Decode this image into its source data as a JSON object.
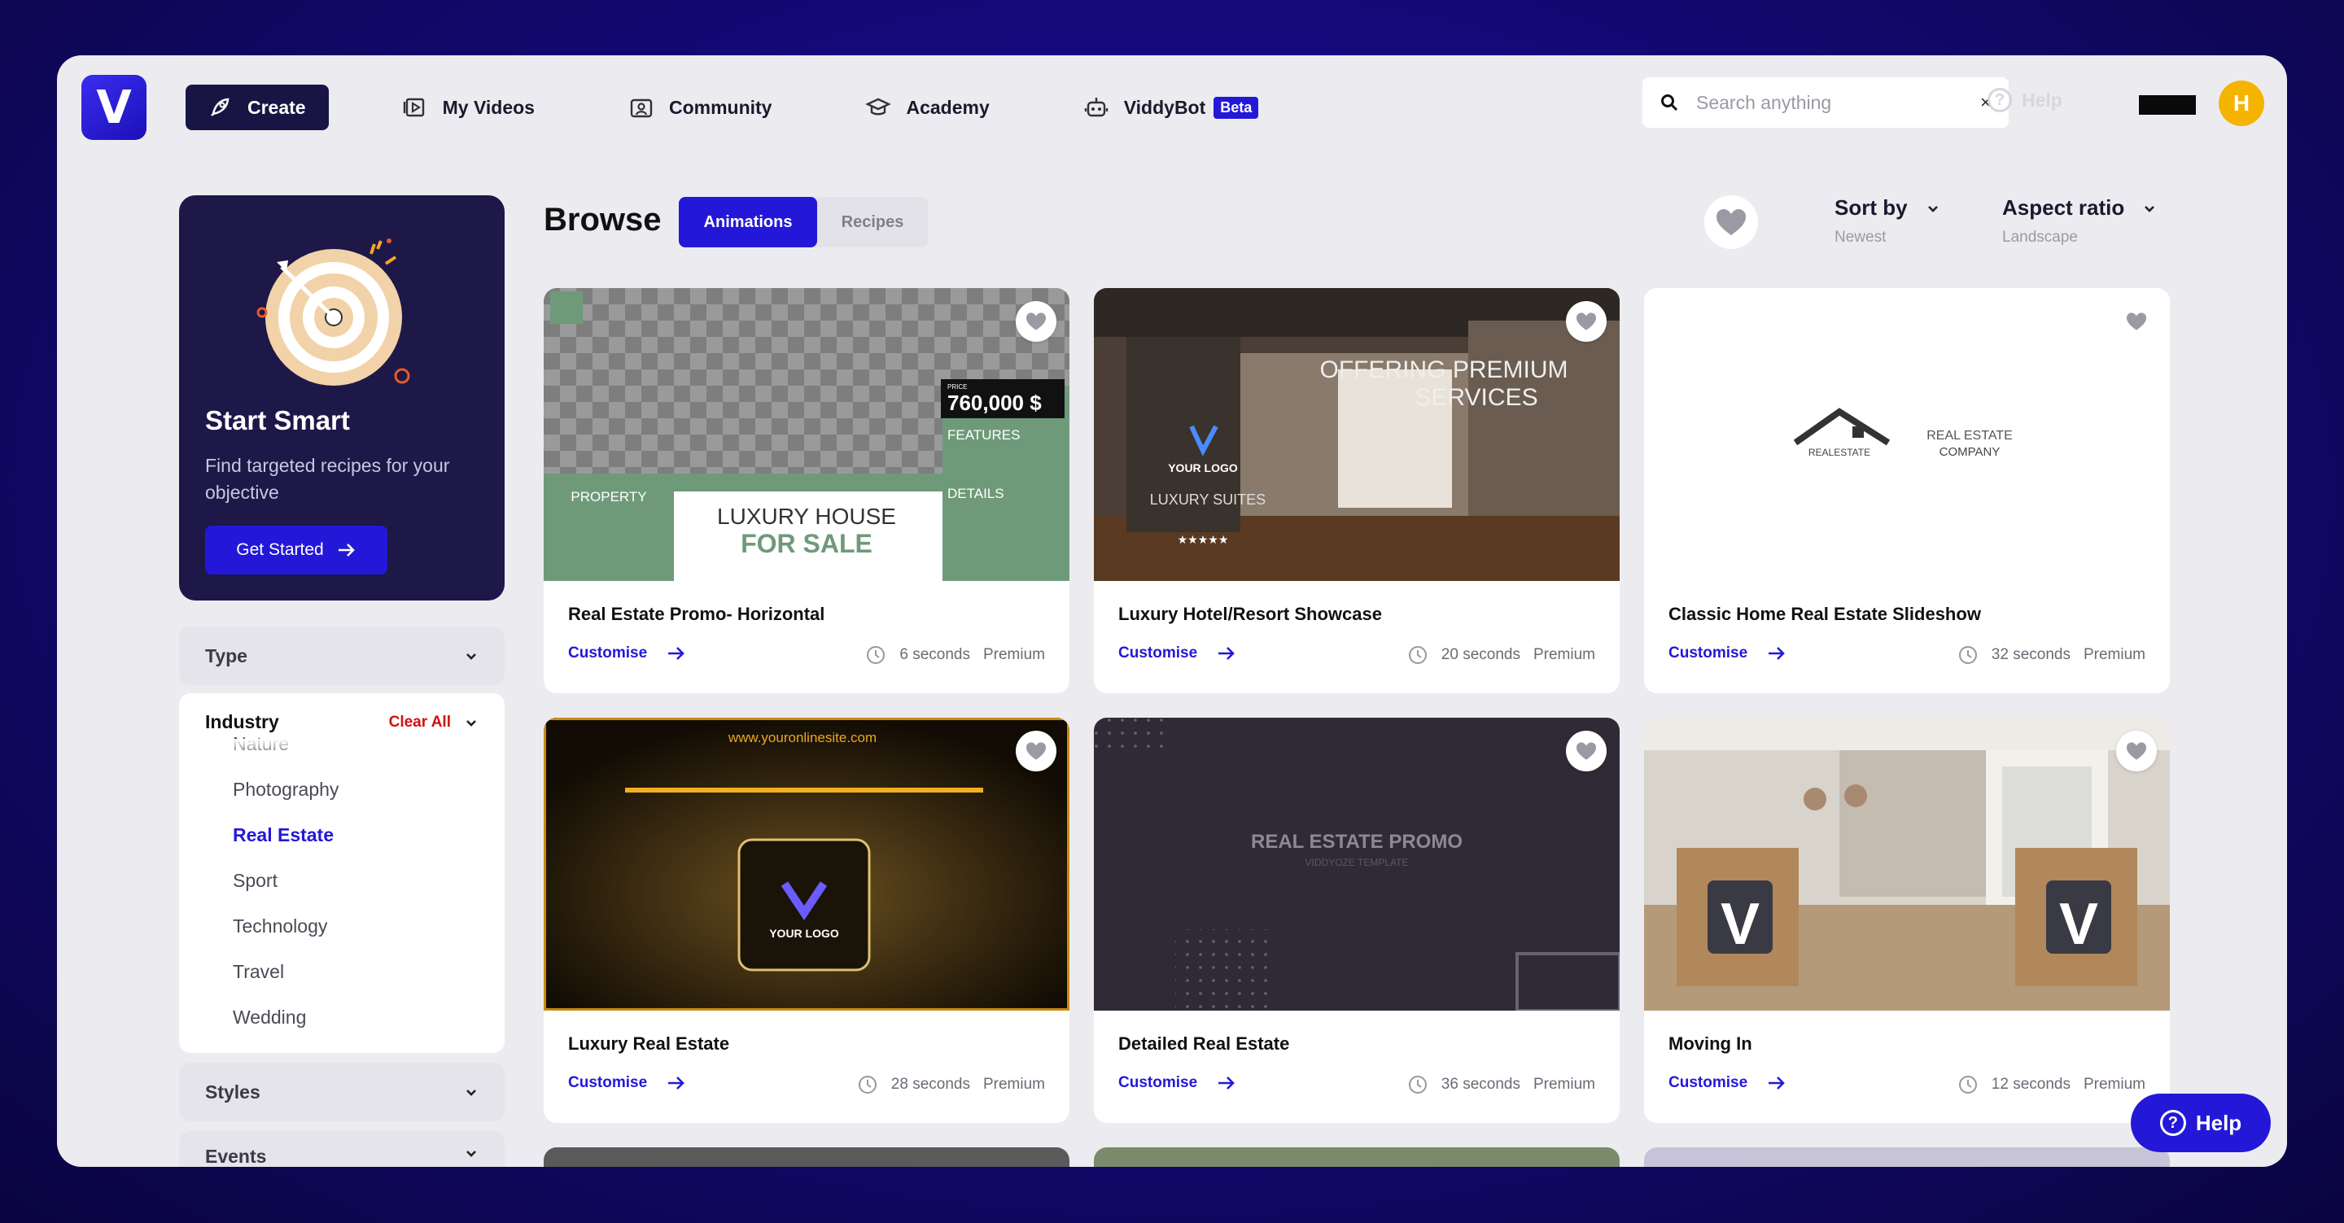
{
  "brand": {
    "logo_letter": "V"
  },
  "nav": {
    "create": "Create",
    "my_videos": "My Videos",
    "community": "Community",
    "academy": "Academy",
    "viddybot": "ViddyBot",
    "beta": "Beta"
  },
  "search": {
    "placeholder": "Search anything",
    "clear": "×"
  },
  "help_top": {
    "icon": "?",
    "label": "Help"
  },
  "user": {
    "initial": "H"
  },
  "promo": {
    "title": "Start Smart",
    "description": "Find targeted recipes for your objective",
    "button": "Get Started"
  },
  "filters": {
    "type": "Type",
    "industry": "Industry",
    "clear_all": "Clear All",
    "industry_options": [
      "Nature",
      "Photography",
      "Real Estate",
      "Sport",
      "Technology",
      "Travel",
      "Wedding"
    ],
    "selected_industry": "Real Estate",
    "styles": "Styles",
    "events": "Events"
  },
  "browse": {
    "title": "Browse",
    "tabs": [
      "Animations",
      "Recipes"
    ],
    "active_tab": "Animations",
    "sort_label": "Sort by",
    "sort_value": "Newest",
    "aspect_label": "Aspect ratio",
    "aspect_value": "Landscape"
  },
  "cards": [
    {
      "title": "Real Estate Promo- Horizontal",
      "action": "Customise",
      "duration": "6 seconds",
      "tier": "Premium"
    },
    {
      "title": "Luxury Hotel/Resort Showcase",
      "action": "Customise",
      "duration": "20 seconds",
      "tier": "Premium"
    },
    {
      "title": "Classic Home Real Estate Slideshow",
      "action": "Customise",
      "duration": "32 seconds",
      "tier": "Premium"
    },
    {
      "title": "Luxury Real Estate",
      "action": "Customise",
      "duration": "28 seconds",
      "tier": "Premium"
    },
    {
      "title": "Detailed Real Estate",
      "action": "Customise",
      "duration": "36 seconds",
      "tier": "Premium"
    },
    {
      "title": "Moving In",
      "action": "Customise",
      "duration": "12 seconds",
      "tier": "Premium"
    }
  ],
  "thumbs": {
    "t1": {
      "price": "760,000 $",
      "price_label": "PRICE",
      "features": "FEATURES",
      "details": "DETAILS",
      "property": "PROPERTY",
      "headline1": "LUXURY HOUSE",
      "headline2": "FOR SALE"
    },
    "t2": {
      "line1": "OFFERING PREMIUM",
      "line2": "SERVICES",
      "logo": "YOUR LOGO",
      "suites": "LUXURY SUITES",
      "stars": "★★★★★"
    },
    "t3": {
      "left": "REALESTATE",
      "right1": "REAL ESTATE",
      "right2": "COMPANY"
    },
    "t4": {
      "url": "www.youronlinesite.com",
      "logo": "YOUR LOGO"
    },
    "t5": {
      "title": "REAL ESTATE PROMO",
      "sub": "VIDDYOZE TEMPLATE"
    },
    "t6": {
      "box_letter": "V"
    }
  },
  "help_fab": {
    "icon": "?",
    "label": "Help"
  },
  "colors": {
    "accent": "#2418d8",
    "dark": "#1d1848",
    "clear": "#d01010",
    "avatar": "#f5b400"
  }
}
